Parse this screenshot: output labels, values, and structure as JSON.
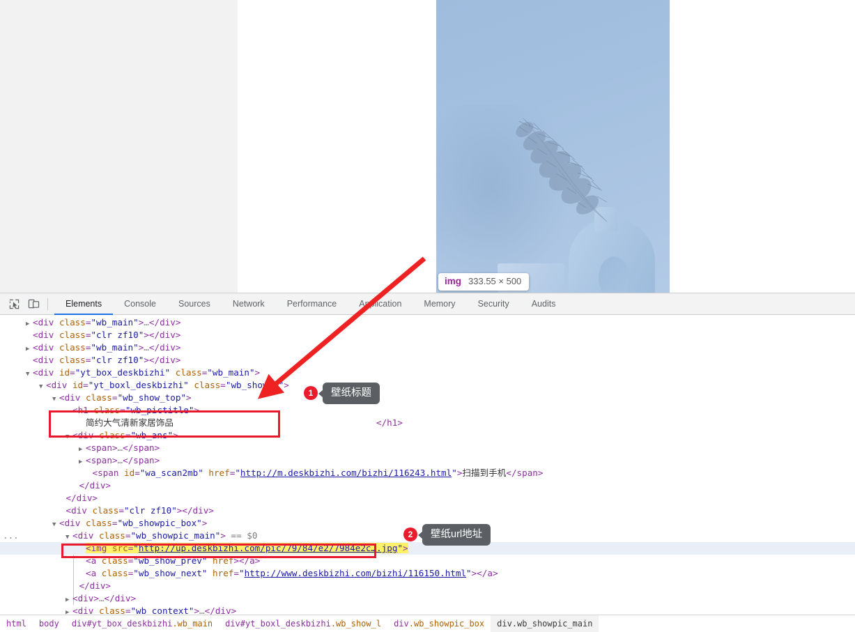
{
  "viewport": {
    "element_tooltip": {
      "tag": "img",
      "dimensions": "333.55 × 500"
    }
  },
  "devtools": {
    "toolbar_icons": [
      "inspect-element-icon",
      "device-toolbar-icon"
    ],
    "tabs": [
      {
        "label": "Elements",
        "active": true
      },
      {
        "label": "Console",
        "active": false
      },
      {
        "label": "Sources",
        "active": false
      },
      {
        "label": "Network",
        "active": false
      },
      {
        "label": "Performance",
        "active": false
      },
      {
        "label": "Application",
        "active": false
      },
      {
        "label": "Memory",
        "active": false
      },
      {
        "label": "Security",
        "active": false
      },
      {
        "label": "Audits",
        "active": false
      }
    ],
    "dom_rows": [
      {
        "id": "r1",
        "twisty": "closed",
        "indent": 2,
        "text_html": "<span class='punct'>&lt;</span><span class='tag'>div</span> <span class='attr'>class</span><span class='punct'>=</span><span class='val'>\"wb_main\"</span><span class='punct'>&gt;</span><span class='ellipsis-dots'>…</span><span class='punct'>&lt;/</span><span class='tag'>div</span><span class='punct'>&gt;</span>"
      },
      {
        "id": "r2",
        "twisty": "none",
        "indent": 2,
        "text_html": "<span class='punct'>&lt;</span><span class='tag'>div</span> <span class='attr'>class</span><span class='punct'>=</span><span class='val'>\"clr zf10\"</span><span class='punct'>&gt;&lt;/</span><span class='tag'>div</span><span class='punct'>&gt;</span>"
      },
      {
        "id": "r3",
        "twisty": "closed",
        "indent": 2,
        "text_html": "<span class='punct'>&lt;</span><span class='tag'>div</span> <span class='attr'>class</span><span class='punct'>=</span><span class='val'>\"wb_main\"</span><span class='punct'>&gt;</span><span class='ellipsis-dots'>…</span><span class='punct'>&lt;/</span><span class='tag'>div</span><span class='punct'>&gt;</span>"
      },
      {
        "id": "r4",
        "twisty": "none",
        "indent": 2,
        "text_html": "<span class='punct'>&lt;</span><span class='tag'>div</span> <span class='attr'>class</span><span class='punct'>=</span><span class='val'>\"clr zf10\"</span><span class='punct'>&gt;&lt;/</span><span class='tag'>div</span><span class='punct'>&gt;</span>"
      },
      {
        "id": "r5",
        "twisty": "open",
        "indent": 2,
        "text_html": "<span class='punct'>&lt;</span><span class='tag'>div</span> <span class='attr'>id</span><span class='punct'>=</span><span class='val'>\"yt_box_deskbizhi\"</span> <span class='attr'>class</span><span class='punct'>=</span><span class='val'>\"wb_main\"</span><span class='punct'>&gt;</span>"
      },
      {
        "id": "r6",
        "twisty": "open",
        "indent": 4,
        "text_html": "<span class='punct'>&lt;</span><span class='tag'>div</span> <span class='attr'>id</span><span class='punct'>=</span><span class='val'>\"yt_boxl_deskbizhi\"</span> <span class='attr'>class</span><span class='punct'>=</span><span class='val'>\"wb_show_l\"</span><span class='punct'>&gt;</span>"
      },
      {
        "id": "r7",
        "twisty": "open",
        "indent": 6,
        "text_html": "<span class='punct'>&lt;</span><span class='tag'>div</span> <span class='attr'>class</span><span class='punct'>=</span><span class='val'>\"wb_show_top\"</span><span class='punct'>&gt;</span>"
      },
      {
        "id": "r8",
        "twisty": "none",
        "indent": 8,
        "text_html": "<span class='punct'>&lt;</span><span class='tag'>h1</span> <span class='attr'>class</span><span class='punct'>=</span><span class='val'>\"wb_pictitle\"</span><span class='punct'>&gt;</span>"
      },
      {
        "id": "r9",
        "twisty": "none",
        "indent": 10,
        "text_html": "<span class='txt'>简约大气清新家居饰品</span>"
      },
      {
        "id": "r10",
        "twisty": "open",
        "indent": 8,
        "text_html": "<span class='punct'>&lt;</span><span class='tag'>div</span> <span class='attr'>class</span><span class='punct'>=</span><span class='val'>\"wb_ans\"</span><span class='punct'>&gt;</span>"
      },
      {
        "id": "r11",
        "twisty": "closed",
        "indent": 10,
        "text_html": "<span class='punct'>&lt;</span><span class='tag'>span</span><span class='punct'>&gt;</span><span class='ellipsis-dots'>…</span><span class='punct'>&lt;/</span><span class='tag'>span</span><span class='punct'>&gt;</span>"
      },
      {
        "id": "r12",
        "twisty": "closed",
        "indent": 10,
        "text_html": "<span class='punct'>&lt;</span><span class='tag'>span</span><span class='punct'>&gt;</span><span class='ellipsis-dots'>…</span><span class='punct'>&lt;/</span><span class='tag'>span</span><span class='punct'>&gt;</span>"
      },
      {
        "id": "r13",
        "twisty": "none",
        "indent": 11,
        "text_html": "<span class='punct'>&lt;</span><span class='tag'>span</span> <span class='attr'>id</span><span class='punct'>=</span><span class='val'>\"wa_scan2mb\"</span> <span class='attr'>href</span><span class='punct'>=</span><span class='val'>\"</span><span class='linkv'>http://m.deskbizhi.com/bizhi/116243.html</span><span class='val'>\"</span><span class='punct'>&gt;</span><span class='txt'>扫描到手机</span><span class='punct'>&lt;/</span><span class='tag'>span</span><span class='punct'>&gt;</span>"
      },
      {
        "id": "r14",
        "twisty": "none",
        "indent": 9,
        "text_html": "<span class='punct'>&lt;/</span><span class='tag'>div</span><span class='punct'>&gt;</span>"
      },
      {
        "id": "r15",
        "twisty": "none",
        "indent": 7,
        "text_html": "<span class='punct'>&lt;/</span><span class='tag'>div</span><span class='punct'>&gt;</span>"
      },
      {
        "id": "r16",
        "twisty": "none",
        "indent": 7,
        "text_html": "<span class='punct'>&lt;</span><span class='tag'>div</span> <span class='attr'>class</span><span class='punct'>=</span><span class='val'>\"clr zf10\"</span><span class='punct'>&gt;&lt;/</span><span class='tag'>div</span><span class='punct'>&gt;</span>"
      },
      {
        "id": "r17",
        "twisty": "open",
        "indent": 6,
        "text_html": "<span class='punct'>&lt;</span><span class='tag'>div</span> <span class='attr'>class</span><span class='punct'>=</span><span class='val'>\"wb_showpic_box\"</span><span class='punct'>&gt;</span>"
      },
      {
        "id": "r18",
        "twisty": "open",
        "indent": 8,
        "text_html": "<span class='punct'>&lt;</span><span class='tag'>div</span> <span class='attr'>class</span><span class='punct'>=</span><span class='val'>\"wb_showpic_main\"</span><span class='punct'>&gt;</span> <span class='meta'>== $0</span>",
        "gutter": "..."
      },
      {
        "id": "r19",
        "twisty": "none",
        "indent": 10,
        "selected": true,
        "text_html": "<span class='hl-yellow'><span class='punct'>&lt;</span><span class='tag'>img</span> <span class='attr'>src</span><span class='punct'>=</span><span class='val'>\"</span><span class='linkv'>http://up.deskbizhi.com/pic/79/84/e2/7984e2c….jpg</span><span class='val'>\"</span><span class='punct'>&gt;</span></span>"
      },
      {
        "id": "r20",
        "twisty": "none",
        "indent": 10,
        "text_html": "<span class='punct'>&lt;</span><span class='tag'>a</span> <span class='attr'>class</span><span class='punct'>=</span><span class='val'>\"wb_show_prev\"</span> <span class='attr'>href</span><span class='punct'>&gt;&lt;/</span><span class='tag'>a</span><span class='punct'>&gt;</span>"
      },
      {
        "id": "r21",
        "twisty": "none",
        "indent": 10,
        "text_html": "<span class='punct'>&lt;</span><span class='tag'>a</span> <span class='attr'>class</span><span class='punct'>=</span><span class='val'>\"wb_show_next\"</span> <span class='attr'>href</span><span class='punct'>=</span><span class='val'>\"</span><span class='linkv'>http://www.deskbizhi.com/bizhi/116150.html</span><span class='val'>\"</span><span class='punct'>&gt;&lt;/</span><span class='tag'>a</span><span class='punct'>&gt;</span>"
      },
      {
        "id": "r22",
        "twisty": "none",
        "indent": 9,
        "text_html": "<span class='punct'>&lt;/</span><span class='tag'>div</span><span class='punct'>&gt;</span>"
      },
      {
        "id": "r23",
        "twisty": "closed",
        "indent": 8,
        "text_html": "<span class='punct'>&lt;</span><span class='tag'>div</span><span class='punct'>&gt;</span><span class='ellipsis-dots'>…</span><span class='punct'>&lt;/</span><span class='tag'>div</span><span class='punct'>&gt;</span>"
      },
      {
        "id": "r24",
        "twisty": "closed",
        "indent": 8,
        "text_html": "<span class='punct'>&lt;</span><span class='tag'>div</span> <span class='attr'>class</span><span class='punct'>=</span><span class='val'>\"wb_context\"</span><span class='punct'>&gt;</span><span class='ellipsis-dots'>…</span><span class='punct'>&lt;/</span><span class='tag'>div</span><span class='punct'>&gt;</span>"
      }
    ],
    "closing_h1": "&lt;/h1&gt;",
    "breadcrumb": [
      {
        "name": "html",
        "cls": "",
        "active": false
      },
      {
        "name": "body",
        "cls": "",
        "active": false
      },
      {
        "name": "div#yt_box_deskbizhi",
        "cls": ".wb_main",
        "active": false
      },
      {
        "name": "div#yt_boxl_deskbizhi",
        "cls": ".wb_show_l",
        "active": false
      },
      {
        "name": "div",
        "cls": ".wb_showpic_box",
        "active": false
      },
      {
        "name": "div",
        "cls": ".wb_showpic_main",
        "active": true
      }
    ]
  },
  "annotations": {
    "callouts": [
      {
        "number": "1",
        "label": "壁纸标题"
      },
      {
        "number": "2",
        "label": "壁纸url地址"
      }
    ],
    "colors": {
      "highlight_box": "#e8192c",
      "badge": "#ea1b2d",
      "callout_bg": "#5b5f63",
      "code_highlight": "#fff06a"
    }
  }
}
